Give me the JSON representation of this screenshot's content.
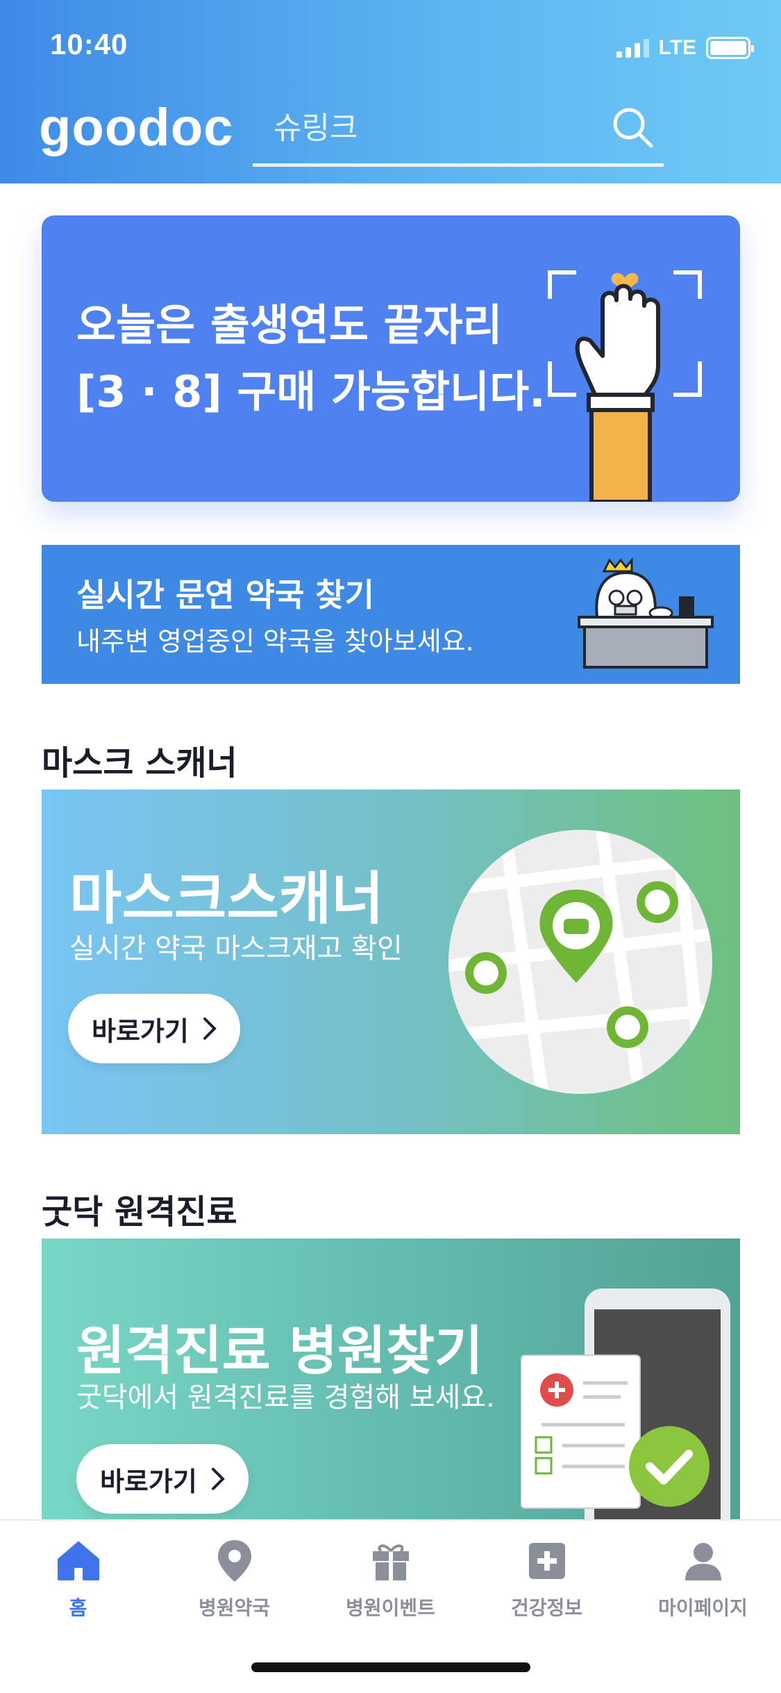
{
  "status_bar": {
    "time": "10:40",
    "network": "LTE",
    "battery_level": 1.0
  },
  "header": {
    "logo": "goodoc",
    "search_placeholder": "슈링크"
  },
  "banner": {
    "line1": "오늘은 출생연도 끝자리",
    "line2": "[3 · 8] 구매 가능합니다."
  },
  "pharmacy_banner": {
    "title": "실시간 문연 약국 찾기",
    "subtitle": "내주변 영업중인 약국을 찾아보세요."
  },
  "mask_section": {
    "heading": "마스크 스캐너",
    "card_title": "마스크스캐너",
    "card_subtitle": "실시간 약국 마스크재고 확인",
    "button_label": "바로가기"
  },
  "tele_section": {
    "heading": "굿닥 원격진료",
    "card_title": "원격진료 병원찾기",
    "card_subtitle": "굿닥에서 원격진료를 경험해 보세요.",
    "button_label": "바로가기"
  },
  "tabs": [
    {
      "label": "홈",
      "icon": "home-icon",
      "active": true
    },
    {
      "label": "병원약국",
      "icon": "map-pin-icon",
      "active": false
    },
    {
      "label": "병원이벤트",
      "icon": "gift-icon",
      "active": false
    },
    {
      "label": "건강정보",
      "icon": "medical-cross-icon",
      "active": false
    },
    {
      "label": "마이페이지",
      "icon": "person-icon",
      "active": false
    }
  ],
  "colors": {
    "accent": "#3e73ec",
    "banner": "#4f81f0",
    "pharmacy": "#3d89e4",
    "inactive_tab": "#8a8f99"
  }
}
